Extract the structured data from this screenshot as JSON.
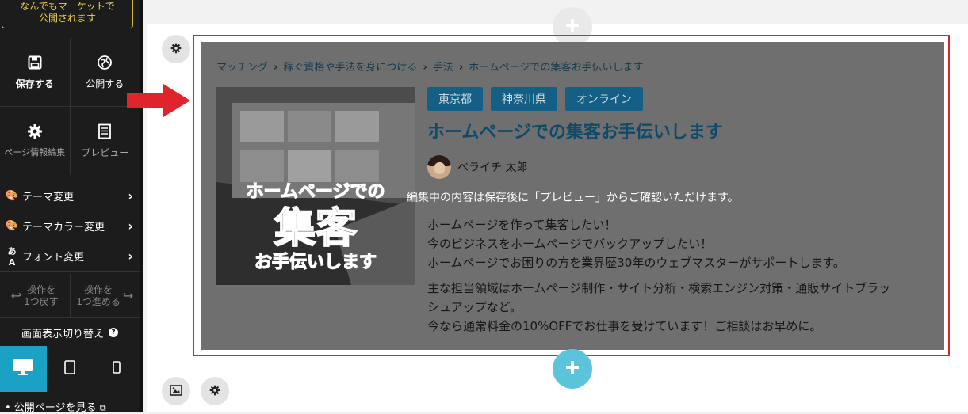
{
  "sidebar": {
    "publish_notice": [
      "なんでもマーケットで",
      "公開されます"
    ],
    "save_label": "保存する",
    "publish_label": "公開する",
    "page_info_label": "ページ情報編集",
    "preview_label": "プレビュー",
    "menu": [
      {
        "label": "テーマ変更",
        "icon": "palette-icon"
      },
      {
        "label": "テーマカラー変更",
        "icon": "color-palette-icon"
      },
      {
        "label": "フォント変更",
        "icon": "font-icon"
      }
    ],
    "undo_label": [
      "操作を",
      "1つ戻す"
    ],
    "redo_label": [
      "操作を",
      "1つ進める"
    ],
    "screen_switch_label": "画面表示切り替え",
    "view_public_label": "• 公開ページを見る",
    "accent_color": "#1ba1c3"
  },
  "breadcrumb": [
    "マッチング",
    "稼ぐ資格や手法を身につける",
    "手法",
    "ホームページでの集客お手伝いします"
  ],
  "tags": [
    "東京都",
    "神奈川県",
    "オンライン"
  ],
  "service": {
    "title": "ホームページでの集客お手伝いします",
    "author": "ベライチ 太郎",
    "thumbnail_text": [
      "ホームページでの",
      "集客",
      "お手伝いします"
    ],
    "description": [
      [
        "ホームページを作って集客したい！",
        "今のビジネスをホームページでバックアップしたい！",
        "ホームページでお困りの方を業界歴30年のウェブマスターがサポートします。"
      ],
      [
        "主な担当領域はホームページ制作・サイト分析・検索エンジン対策・通販サイトブラッ",
        "シュアップなど。",
        "今なら通常料金の10%OFFでお仕事を受けています！ご相談はお早めに。"
      ]
    ]
  },
  "overlay_message": "編集中の内容は保存後に「プレビュー」からご確認いただけます。",
  "colors": {
    "highlight_frame": "#e0242c",
    "tag_bg": "#135f85",
    "add_button": "#5bc4dc"
  }
}
